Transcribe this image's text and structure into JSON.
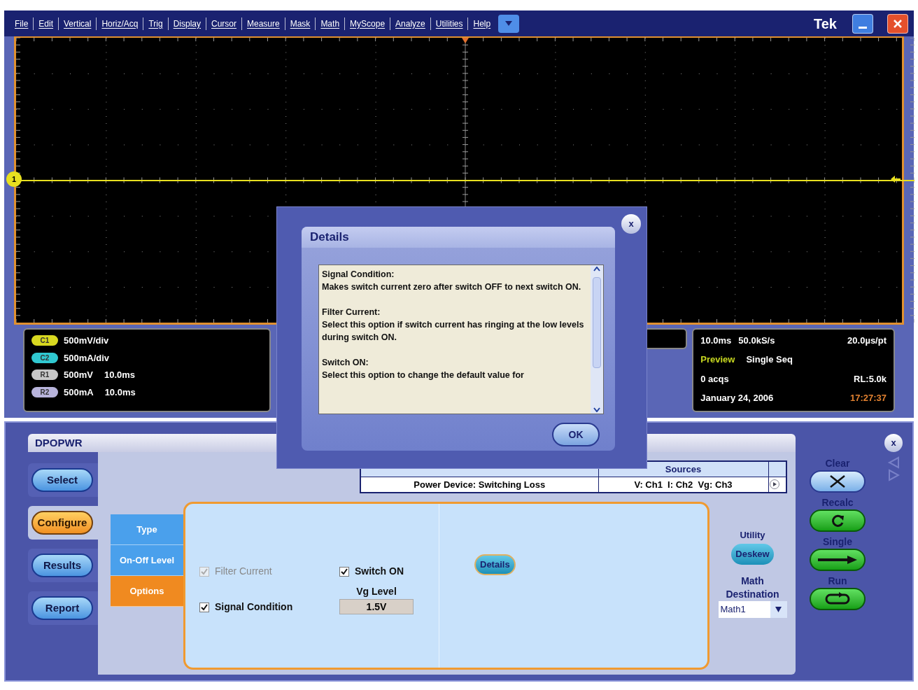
{
  "menu_bar": {
    "items": [
      "File",
      "Edit",
      "Vertical",
      "Horiz/Acq",
      "Trig",
      "Display",
      "Cursor",
      "Measure",
      "Mask",
      "Math",
      "MyScope",
      "Analyze",
      "Utilities",
      "Help"
    ],
    "brand": "Tek"
  },
  "waveform": {
    "channel_marker": "1"
  },
  "channel_readouts": [
    {
      "badge": "C1",
      "color": "#d8d820",
      "scale": "500mV/div"
    },
    {
      "badge": "C2",
      "color": "#30c8d0",
      "scale": "500mA/div"
    },
    {
      "badge": "R1",
      "color": "#c8c8c8",
      "scale": "500mV",
      "time": "10.0ms"
    },
    {
      "badge": "R2",
      "color": "#b8b4dc",
      "scale": "500mA",
      "time": "10.0ms"
    }
  ],
  "acquisition_readout": {
    "timebase": "10.0ms",
    "sample_rate": "50.0kS/s",
    "resolution": "20.0µs/pt",
    "mode": "Preview",
    "run_mode": "Single Seq",
    "acqs": "0 acqs",
    "record_length": "RL:5.0k",
    "date": "January 24, 2006",
    "time": "17:27:37"
  },
  "app": {
    "title": "DPOPWR",
    "close": "x",
    "nav": [
      {
        "label": "Select",
        "selected": false
      },
      {
        "label": "Configure",
        "selected": true
      },
      {
        "label": "Results",
        "selected": false
      },
      {
        "label": "Report",
        "selected": false
      }
    ],
    "table": {
      "columns": [
        "",
        "Sources"
      ],
      "rows": [
        [
          "Power Device: Switching Loss",
          "V: Ch1  I: Ch2  Vg: Ch3"
        ]
      ]
    },
    "tabs": [
      {
        "label": "Type",
        "selected": false
      },
      {
        "label": "On-Off Level",
        "selected": false
      },
      {
        "label": "Options",
        "selected": true
      }
    ],
    "options": [
      {
        "label": "Filter Current",
        "checked": true,
        "disabled": true
      },
      {
        "label": "Switch ON",
        "checked": true,
        "disabled": false
      },
      {
        "label": "Signal Condition",
        "checked": true,
        "disabled": false
      }
    ],
    "vg_level": {
      "label": "Vg Level",
      "value": "1.5V"
    },
    "details_button": "Details",
    "utility": {
      "label": "Utility",
      "button": "Deskew"
    },
    "math_destination": {
      "label": "Math Destination",
      "value": "Math1"
    },
    "controls": [
      {
        "label": "Clear",
        "kind": "clear"
      },
      {
        "label": "Recalc",
        "kind": "recalc"
      },
      {
        "label": "Single",
        "kind": "single"
      },
      {
        "label": "Run",
        "kind": "run"
      }
    ]
  },
  "dialog": {
    "title": "Details",
    "close": "x",
    "paragraphs": [
      {
        "heading": "Signal Condition:",
        "text": "Makes switch current zero after switch OFF to next switch ON."
      },
      {
        "heading": "Filter Current:",
        "text": "Select this option if switch current has ringing at the low levels during switch ON."
      },
      {
        "heading": "Switch ON:",
        "text": "Select this option to change the default value for"
      }
    ],
    "ok": "OK"
  }
}
